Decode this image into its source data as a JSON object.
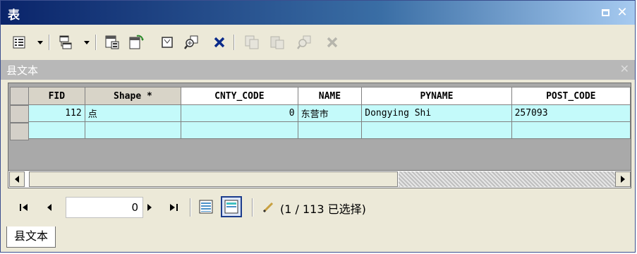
{
  "window": {
    "title": "表"
  },
  "toolbar": {
    "tools": [
      {
        "name": "table-options-icon",
        "enabled": true
      },
      {
        "name": "related-tables-icon",
        "enabled": true
      },
      {
        "name": "select-by-attributes-icon",
        "enabled": true
      },
      {
        "name": "switch-selection-icon",
        "enabled": true
      },
      {
        "name": "clear-selection-icon",
        "enabled": true
      },
      {
        "name": "zoom-to-selected-icon",
        "enabled": true
      },
      {
        "name": "delete-selected-icon",
        "enabled": true
      },
      {
        "name": "copy-selected-icon",
        "enabled": false
      },
      {
        "name": "paste-icon",
        "enabled": false
      },
      {
        "name": "zoom-disabled-icon",
        "enabled": false
      },
      {
        "name": "delete-disabled-icon",
        "enabled": false
      }
    ]
  },
  "grid": {
    "title": "县文本",
    "columns": [
      "FID",
      "Shape *",
      "CNTY_CODE",
      "NAME",
      "PYNAME",
      "POST_CODE"
    ],
    "rows": [
      {
        "FID": "112",
        "Shape": "点",
        "CNTY_CODE": "0",
        "NAME": "东营市",
        "PYNAME": "Dongying Shi",
        "POST_CODE": "257093"
      }
    ]
  },
  "navigation": {
    "record_value": "0",
    "selection_text": "(1 / 113 已选择)"
  },
  "tabs": [
    {
      "label": "县文本"
    }
  ],
  "colors": {
    "title_gradient_start": "#0a246a",
    "title_gradient_end": "#a6caf0",
    "row_highlight": "#c4fafa",
    "grid_background": "#a9a9a9",
    "chrome": "#ece9d8"
  }
}
